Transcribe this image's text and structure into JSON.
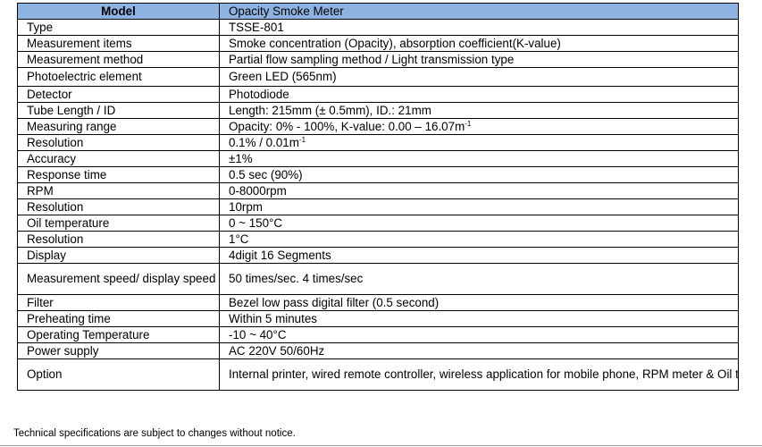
{
  "header": {
    "model_label": "Model",
    "model_value": "Opacity Smoke Meter"
  },
  "rows": [
    {
      "label": "Type",
      "value": "TSSE-801"
    },
    {
      "label": "Measurement items",
      "value": "Smoke concentration (Opacity), absorption coefficient(K-value)"
    },
    {
      "label": "Measurement method",
      "value": "Partial flow sampling method / Light transmission type"
    },
    {
      "label": "Photoelectric element",
      "value": "Green LED (565nm)"
    },
    {
      "label": "Detector",
      "value": "Photodiode"
    },
    {
      "label": "Tube Length / ID",
      "value": "Length: 215mm (± 0.5mm), ID.: 21mm"
    },
    {
      "label": "Measuring range",
      "value": "Opacity: 0% - 100%, K-value: 0.00 – 16.07m",
      "sup": "-1"
    },
    {
      "label": "Resolution",
      "value": "0.1% / 0.01m",
      "sup": "-1"
    },
    {
      "label": "Accuracy",
      "value": "±1%"
    },
    {
      "label": "Response time",
      "value": "0.5 sec (90%)"
    },
    {
      "label": "RPM",
      "value": "0-8000rpm"
    },
    {
      "label": "Resolution",
      "value": "10rpm"
    },
    {
      "label": "Oil temperature",
      "value": "0 ~ 150°C"
    },
    {
      "label": "Resolution",
      "value": "1°C"
    },
    {
      "label": "Display",
      "value": "4digit 16 Segments"
    },
    {
      "label": "Measurement speed/ display speed",
      "value": "50 times/sec.  4 times/sec"
    },
    {
      "label": "Filter",
      "value": "Bezel low pass digital filter (0.5 second)"
    },
    {
      "label": "Preheating time",
      "value": "Within 5 minutes"
    },
    {
      "label": "Operating Temperature",
      "value": "-10 ~ 40°C"
    },
    {
      "label": "Power supply",
      "value": "AC 220V 50/60Hz"
    },
    {
      "label": "Option",
      "value": "Internal printer, wired remote controller, wireless application for mobile phone, RPM meter & Oil temperature meter, Standard filters"
    }
  ],
  "footer": {
    "note": "Technical specifications are subject to changes without notice."
  },
  "colors": {
    "header_bg": "#8db3e2",
    "border": "#000000"
  }
}
